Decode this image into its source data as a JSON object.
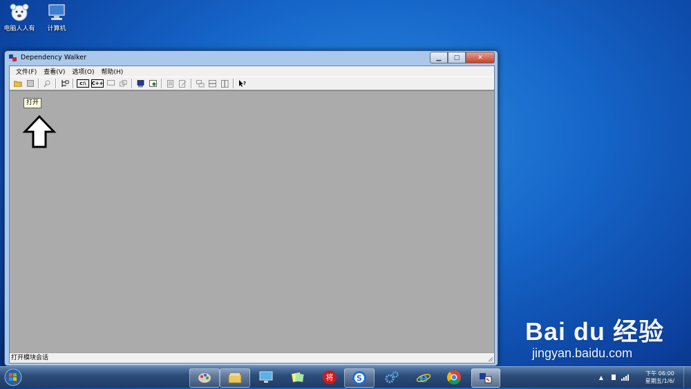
{
  "desktop": {
    "icons": [
      {
        "label": "电脑人人有"
      },
      {
        "label": "计算机"
      }
    ]
  },
  "window": {
    "title": "Dependency Walker",
    "menu": [
      "文件(F)",
      "查看(V)",
      "选项(O)",
      "帮助(H)"
    ],
    "toolbar": {
      "path_button": "c:\\",
      "cpp_button": "C++"
    },
    "tooltip": "打开",
    "status": "打开模块会话"
  },
  "taskbar": {
    "clock_time": "下午 06:00",
    "clock_date": "星期五/1/6/"
  },
  "watermark": {
    "brand_text": "Bai du 经验",
    "url": "jingyan.baidu.com"
  }
}
